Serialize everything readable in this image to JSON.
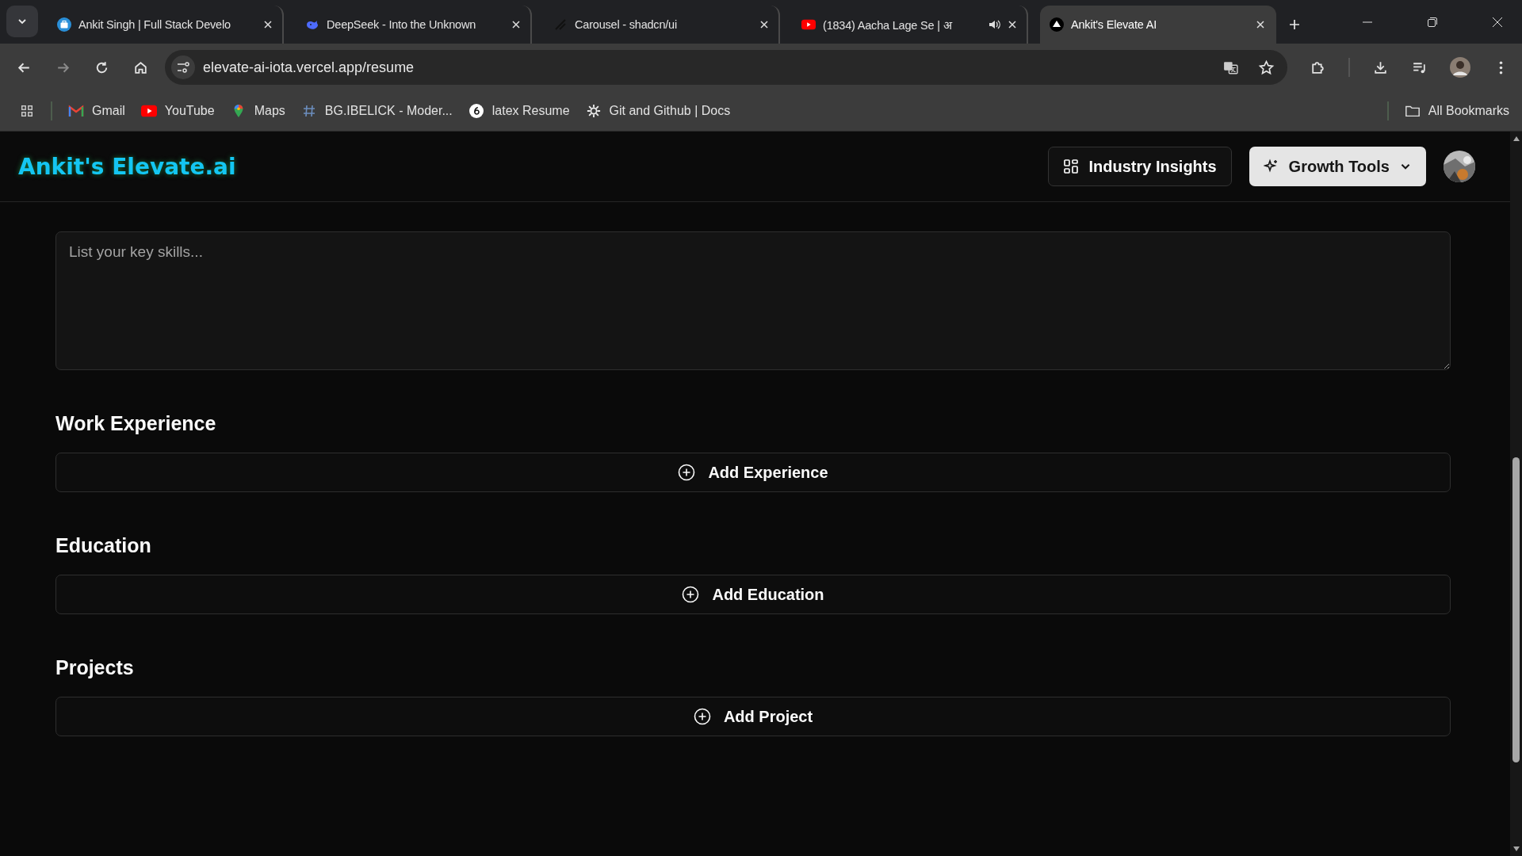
{
  "browser": {
    "tabs": [
      {
        "title": "Ankit Singh | Full Stack Develo",
        "selected": false,
        "audio": false
      },
      {
        "title": "DeepSeek - Into the Unknown",
        "selected": false,
        "audio": false
      },
      {
        "title": "Carousel - shadcn/ui",
        "selected": false,
        "audio": false
      },
      {
        "title": "(1834) Aacha Lage Se | अ",
        "selected": false,
        "audio": true
      },
      {
        "title": "Ankit's Elevate AI",
        "selected": true,
        "audio": false
      }
    ],
    "address": "elevate-ai-iota.vercel.app/resume",
    "bookmarks": [
      "Gmail",
      "YouTube",
      "Maps",
      "BG.IBELICK - Moder...",
      "latex Resume",
      "Git and Github | Docs"
    ],
    "all_bookmarks": "All Bookmarks"
  },
  "header": {
    "logo": "Ankit's Elevate.ai",
    "nav": [
      {
        "label": "Industry Insights",
        "kind": "outline"
      },
      {
        "label": "Growth Tools",
        "kind": "solid"
      }
    ]
  },
  "form": {
    "skills": {
      "placeholder": "List your key skills..."
    },
    "sections": [
      {
        "title": "Work Experience",
        "button": "Add Experience"
      },
      {
        "title": "Education",
        "button": "Add Education"
      },
      {
        "title": "Projects",
        "button": "Add Project"
      }
    ]
  }
}
